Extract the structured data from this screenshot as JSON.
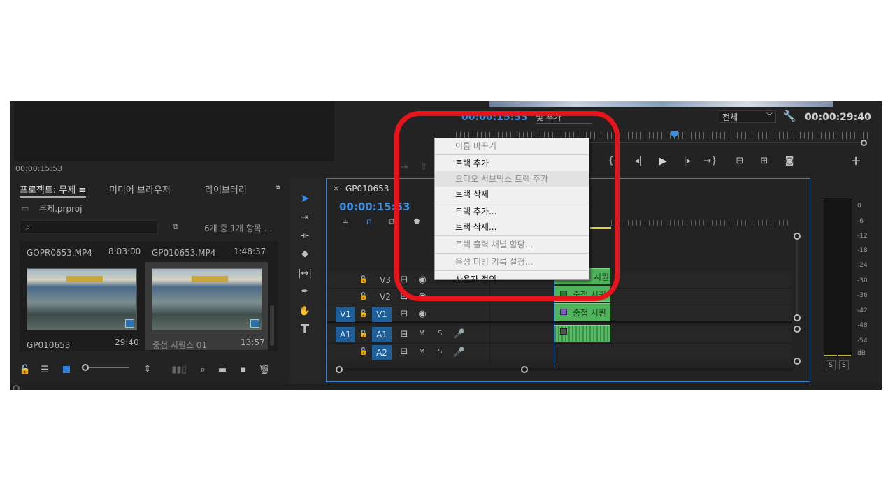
{
  "source_monitor": {
    "timecode": "00:00:15:53"
  },
  "program_monitor": {
    "timecode_left": "00:00:15:53",
    "add_marker_dropdown": "및 추가",
    "fit_dropdown": "전체",
    "timecode_right": "00:00:29:40"
  },
  "project_panel": {
    "tabs": [
      "프로젝트: 무제",
      "미디어 브라우저",
      "라이브러리"
    ],
    "project_file": "무제.prproj",
    "search_placeholder": "",
    "item_count": "6개 중 1개 항목 ...",
    "items": [
      {
        "name": "GOPR0653.MP4",
        "duration": "8:03:00"
      },
      {
        "name": "GP010653.MP4",
        "duration": "1:48:37"
      },
      {
        "name": "GP010653",
        "duration": "29:40"
      },
      {
        "name": "중첩 시퀀스 01",
        "duration": "13:57"
      }
    ]
  },
  "timeline": {
    "sequence_tab": "GP010653",
    "timecode": "00:00:15:53",
    "tracks": [
      {
        "name": "V3",
        "type": "video"
      },
      {
        "name": "V2",
        "type": "video"
      },
      {
        "name": "V1",
        "type": "video",
        "source": "V1"
      },
      {
        "name": "A1",
        "type": "audio",
        "source": "A1"
      },
      {
        "name": "A2",
        "type": "audio"
      }
    ],
    "clips": [
      {
        "track": "V3",
        "label": "시퀀"
      },
      {
        "track": "V2",
        "label": "중첩 시퀀"
      },
      {
        "track": "V1",
        "label": "중첩 시퀀"
      }
    ],
    "mute_label": "M",
    "solo_label": "S"
  },
  "context_menu": {
    "items": [
      {
        "label": "이름 바꾸기",
        "enabled": false
      },
      {
        "label": "트랙 추가",
        "enabled": true
      },
      {
        "label": "오디오 서브믹스 트랙 추가",
        "enabled": false,
        "highlighted": true
      },
      {
        "label": "트랙 삭제",
        "enabled": true
      },
      {
        "label": "트랙 추가...",
        "enabled": true
      },
      {
        "label": "트랙 삭제...",
        "enabled": true
      },
      {
        "label": "트랙 출력 채널 할당...",
        "enabled": false
      },
      {
        "label": "음성 더빙 기록 설정...",
        "enabled": false
      },
      {
        "label": "사용자 정의...",
        "enabled": true
      }
    ]
  },
  "audio_meter": {
    "scale": [
      "0",
      "-6",
      "-12",
      "-18",
      "-24",
      "-30",
      "-36",
      "-42",
      "-48",
      "-54",
      "dB"
    ],
    "solo_buttons": [
      "S",
      "S"
    ]
  },
  "annotation": {
    "color": "#e8141b"
  }
}
